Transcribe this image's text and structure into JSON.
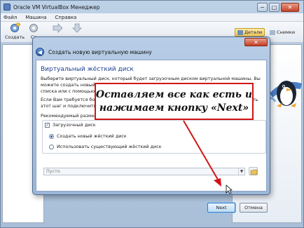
{
  "window": {
    "title": "Oracle VM VirtualBox Менеджер",
    "minimize": "−",
    "maximize": "□",
    "close": "✕"
  },
  "menu": [
    "Файл",
    "Машина",
    "Справка"
  ],
  "toolbar": {
    "create": "Создать",
    "settings": "Св",
    "details": "Детали",
    "snapshots": "Снимки"
  },
  "dialog": {
    "title": "Создать новую виртуальную машину",
    "close": "✕",
    "back_icon": "arrow-left-icon",
    "section_title": "Виртуальный жёсткий диск",
    "desc1": "Выберите виртуальный диск, который будет загрузочным диском виртуальной машины. Вы можете создать новый жёсткий диск или выбрать уже существующий из выпадающего списка или с помощью диалога открытия файла.",
    "desc2": "Если Вам требуется более сложная конфигурация жёстких дисков, Вы можете пропустить этот шаг и подключить диски позднее с помощью",
    "recommend": "Рекомендуемый размер з",
    "boot_checkbox": "Загрузочный диск",
    "radio_new": "Создать новый жёсткий диск",
    "radio_existing": "Использовать существующий жёсткий диск",
    "combo_value": "Пусто",
    "next": "Next",
    "cancel": "Отмена"
  },
  "annotation": {
    "line1": "Оставляем все как есть и",
    "line2": "нажимаем кнопку «Next»",
    "color": "#d11515"
  }
}
